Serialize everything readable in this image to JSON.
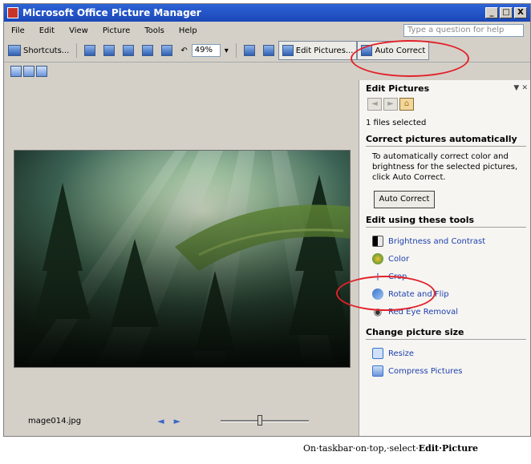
{
  "window": {
    "title": "Microsoft Office Picture Manager",
    "controls": [
      "_",
      "□",
      "X"
    ]
  },
  "menu": {
    "items": [
      "File",
      "Edit",
      "View",
      "Picture",
      "Tools",
      "Help"
    ],
    "help_placeholder": "Type a question for help"
  },
  "toolbar": {
    "shortcuts_label": "Shortcuts...",
    "zoom": "49%",
    "edit_pictures_label": "Edit Pictures...",
    "auto_correct_label": "Auto Correct"
  },
  "status": {
    "filename": "mage014.jpg",
    "prev": "◄",
    "next": "►"
  },
  "pane": {
    "title": "Edit Pictures",
    "files_selected": "1 files selected",
    "correct_title": "Correct pictures automatically",
    "correct_desc": "To automatically correct color and brightness for the selected pictures, click Auto Correct.",
    "auto_correct_button": "Auto Correct",
    "tools_title": "Edit using these tools",
    "tools": [
      "Brightness and Contrast",
      "Color",
      "Crop",
      "Rotate and Flip",
      "Red Eye Removal"
    ],
    "size_title": "Change picture size",
    "size_tools": [
      "Resize",
      "Compress Pictures"
    ]
  },
  "doc": {
    "prefix": "On·taskbar·on·top,·select·",
    "bold": "Edit·Picture"
  },
  "colors": {
    "accent": "#2d63d6",
    "link": "#1d3fae",
    "highlight": "#e2222a"
  }
}
